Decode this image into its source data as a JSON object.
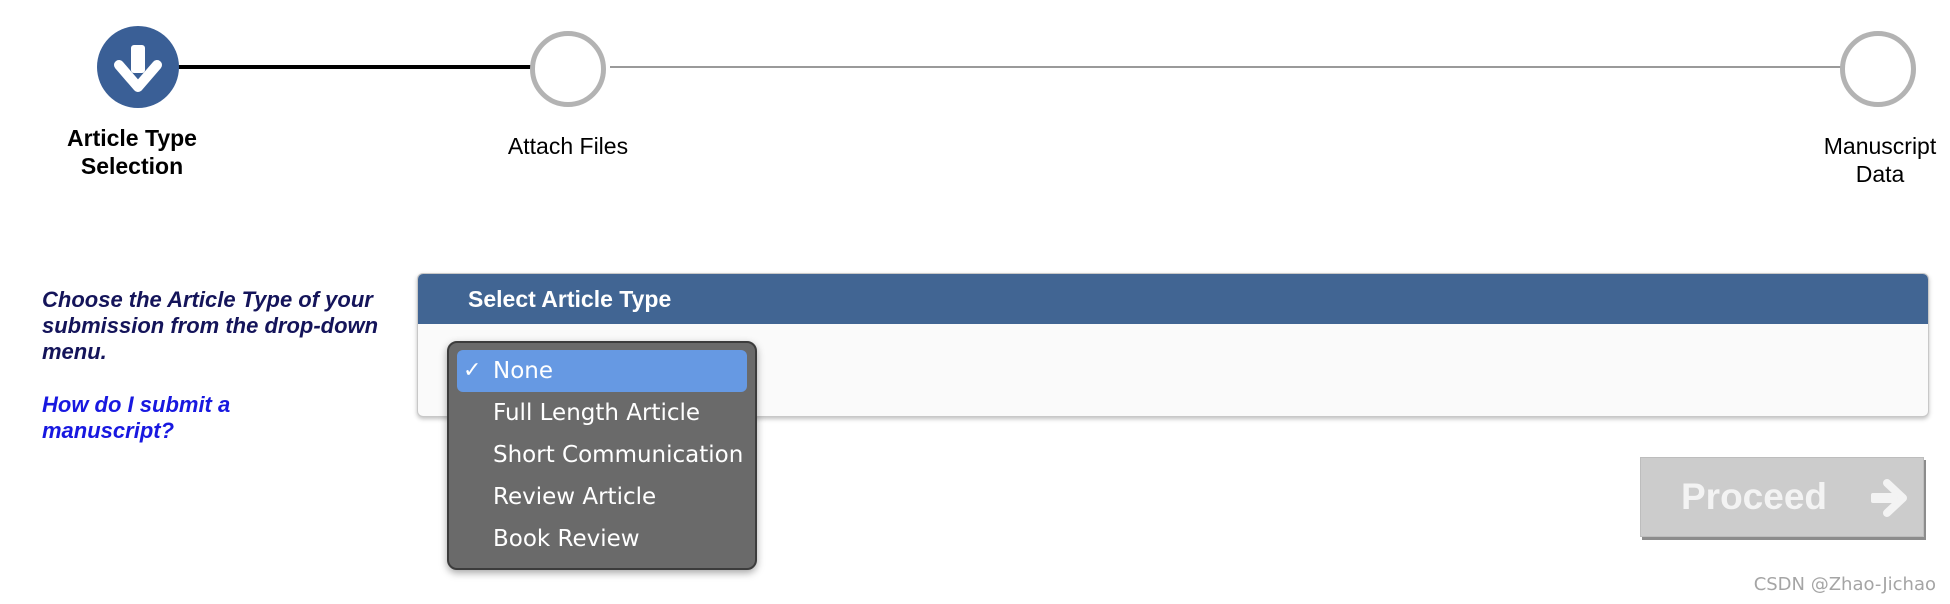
{
  "stepper": {
    "steps": [
      {
        "label_line1": "Article Type",
        "label_line2": "Selection",
        "state": "active"
      },
      {
        "label_line1": "Attach Files",
        "state": "pending"
      },
      {
        "label_line1": "Manuscript",
        "label_line2": "Data",
        "state": "pending"
      }
    ],
    "active_icon": "arrow-down-icon",
    "active_color": "#3a5f96"
  },
  "instructions": {
    "text": "Choose the Article Type of your submission from the drop-down menu.",
    "help_link": "How do I submit a manuscript?"
  },
  "panel": {
    "header": "Select Article Type",
    "header_color": "#416593"
  },
  "article_type_menu": {
    "check_mark": "✓",
    "selected_index": 0,
    "options": [
      "None",
      "Full Length Article",
      "Short Communication",
      "Review Article",
      "Book Review"
    ]
  },
  "proceed_button": {
    "label": "Proceed",
    "icon": "arrow-right-icon",
    "state": "disabled"
  },
  "watermark": "CSDN @Zhao-Jichao"
}
